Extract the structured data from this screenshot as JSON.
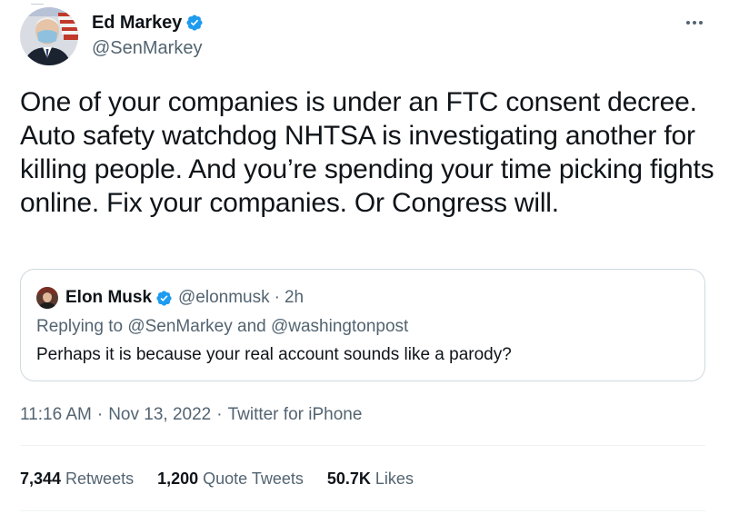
{
  "author": {
    "display_name": "Ed Markey",
    "handle": "@SenMarkey",
    "verified": true
  },
  "tweet": {
    "text": "One of your companies is under an FTC consent decree. Auto safety watchdog NHTSA is investigating another for killing people. And you’re spending your time picking fights online. Fix your companies. Or Congress will."
  },
  "quote": {
    "display_name": "Elon Musk",
    "handle": "@elonmusk",
    "separator": "·",
    "time": "2h",
    "replying_to": "Replying to @SenMarkey and @washingtonpost",
    "text": "Perhaps it is because your real account sounds like a parody?"
  },
  "meta": {
    "time": "11:16 AM",
    "separator": "·",
    "date": "Nov 13, 2022",
    "source": "Twitter for iPhone"
  },
  "stats": {
    "retweets": {
      "count": "7,344",
      "label": "Retweets"
    },
    "quote_tweets": {
      "count": "1,200",
      "label": "Quote Tweets"
    },
    "likes": {
      "count": "50.7K",
      "label": "Likes"
    }
  },
  "colors": {
    "verified_blue": "#1d9bf0",
    "secondary_text": "#536471",
    "primary_text": "#0f1419",
    "border": "#cfd9de"
  },
  "icons": {
    "verified": "verified-badge-icon",
    "more": "more-horizontal-icon"
  }
}
